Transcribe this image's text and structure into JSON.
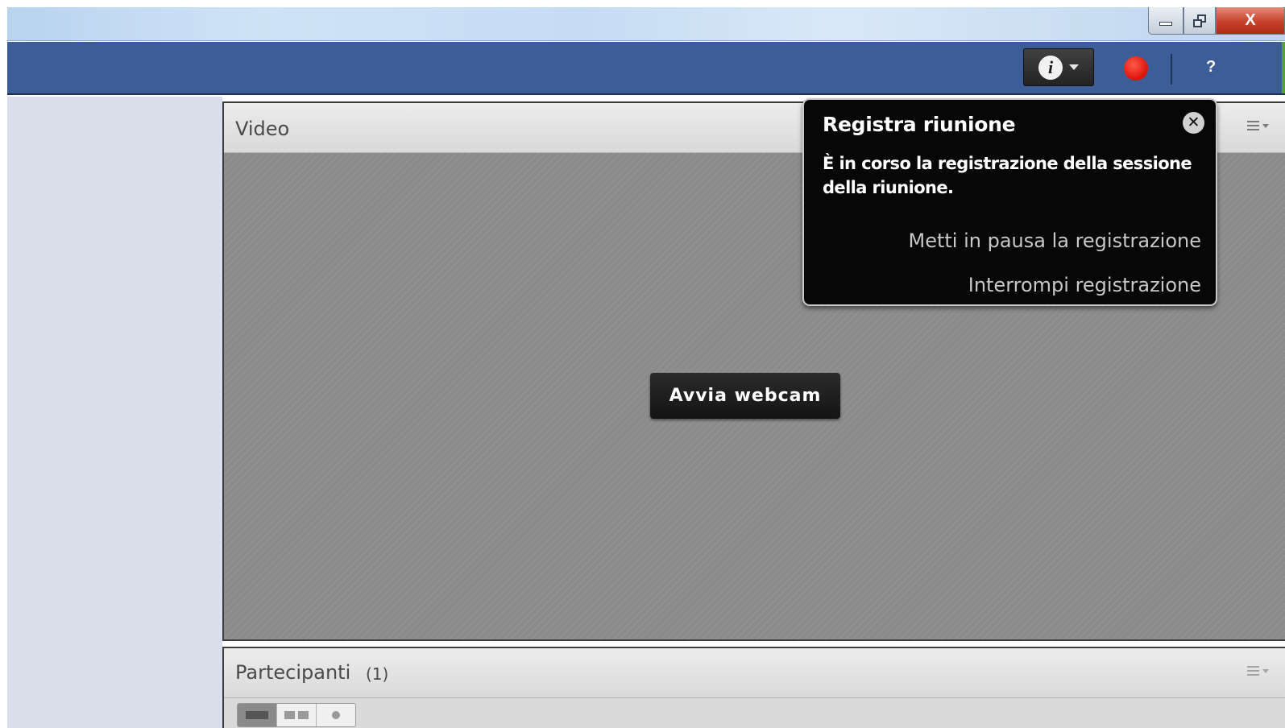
{
  "window": {
    "close_glyph": "X",
    "controls": [
      "minimize-icon",
      "restore-icon",
      "close-icon"
    ]
  },
  "toolbar": {
    "info_icon_glyph": "i",
    "help_label": "?",
    "record_color": "#e01b10",
    "bar_color": "#3d5d99"
  },
  "video_pod": {
    "title": "Video",
    "start_webcam_label": "Avvia webcam"
  },
  "record_popup": {
    "title": "Registra riunione",
    "close_glyph": "✕",
    "message": "È in corso la registrazione della sessione della riunione.",
    "pause_label": "Metti in pausa la registrazione",
    "stop_label": "Interrompi registrazione"
  },
  "participants_pod": {
    "title": "Partecipanti",
    "count": "(1)"
  }
}
